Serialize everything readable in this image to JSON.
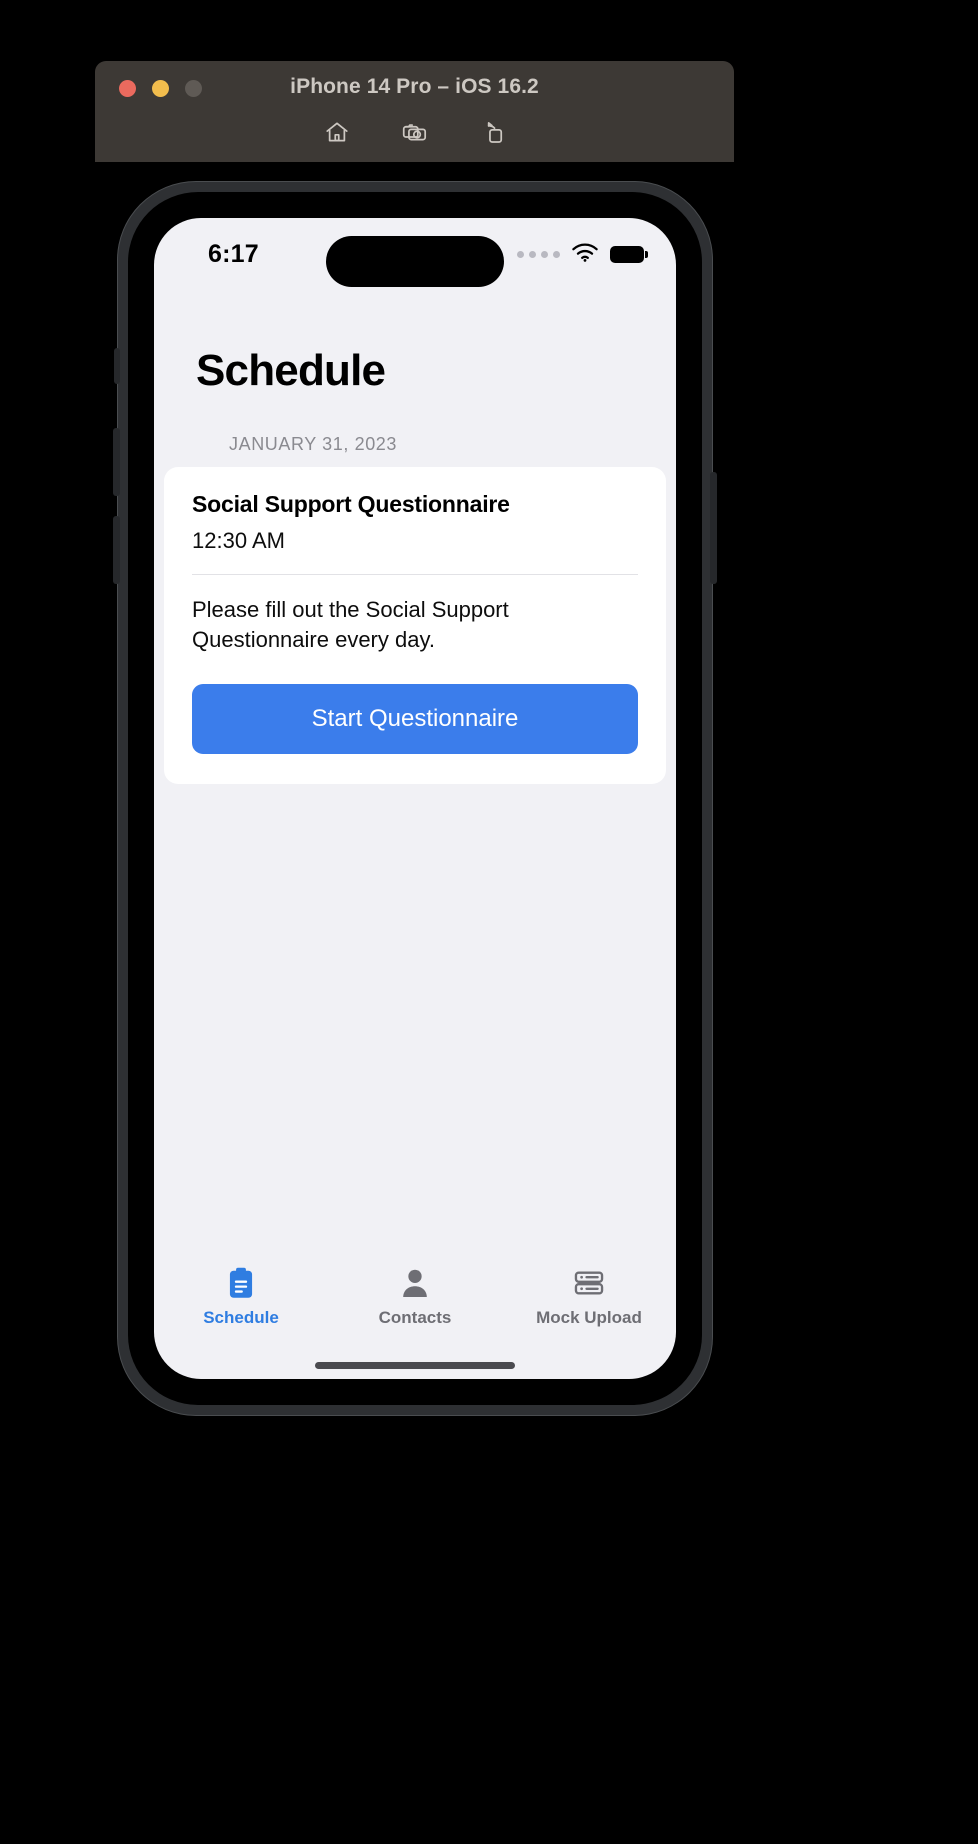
{
  "simulator": {
    "title": "iPhone 14 Pro – iOS 16.2",
    "window_controls": [
      {
        "name": "close",
        "color": "#eb6a5e"
      },
      {
        "name": "minimize",
        "color": "#f2bd4d"
      },
      {
        "name": "zoom",
        "color": "#5f5a55"
      }
    ],
    "toolbar": [
      {
        "icon": "home-icon",
        "label": "Home"
      },
      {
        "icon": "screenshot-icon",
        "label": "Screenshot"
      },
      {
        "icon": "rotate-icon",
        "label": "Rotate"
      }
    ],
    "chrome_color": "#3d3935",
    "title_color": "#cdc8c2"
  },
  "status_bar": {
    "time": "6:17",
    "signal_icon": "cellular-dots-icon",
    "wifi_icon": "wifi-icon",
    "battery_icon": "battery-full-icon"
  },
  "app": {
    "page_title": "Schedule",
    "date_label": "JANUARY 31, 2023",
    "card": {
      "title": "Social Support Questionnaire",
      "time": "12:30 AM",
      "description": "Please fill out the Social Support Questionnaire every day.",
      "button_label": "Start Questionnaire",
      "button_color": "#3b7deb"
    },
    "tabs": [
      {
        "label": "Schedule",
        "icon": "clipboard-icon",
        "active": true
      },
      {
        "label": "Contacts",
        "icon": "person-icon",
        "active": false
      },
      {
        "label": "Mock Upload",
        "icon": "server-stack-icon",
        "active": false
      }
    ],
    "accent_color": "#2f7de1",
    "background_color": "#f1f1f5",
    "card_background": "#ffffff"
  }
}
